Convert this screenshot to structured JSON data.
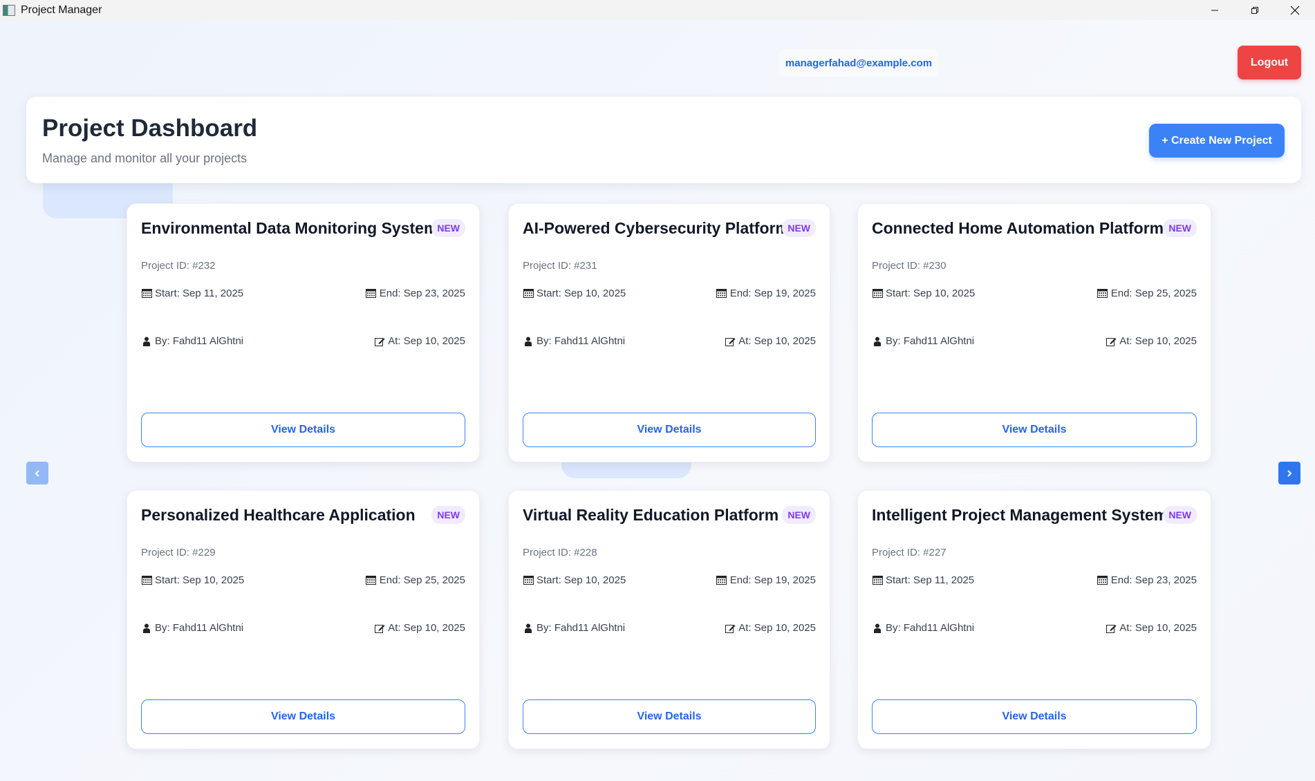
{
  "window": {
    "title": "Project Manager"
  },
  "header": {
    "user_email": "managerfahad@example.com",
    "logout_label": "Logout"
  },
  "dashboard": {
    "title": "Project Dashboard",
    "subtitle": "Manage and monitor all your projects",
    "create_label": "+ Create New Project"
  },
  "carousel": {
    "prev_label": "<",
    "next_label": ">"
  },
  "projects": [
    {
      "title": "Environmental Data Monitoring System",
      "badge": "NEW",
      "id_text": "Project ID: #232",
      "start": "Start: Sep 11, 2025",
      "end": "End: Sep 23, 2025",
      "by": "By: Fahd11 AlGhtni",
      "at": "At: Sep 10, 2025",
      "view_label": "View Details"
    },
    {
      "title": "AI-Powered Cybersecurity Platform",
      "badge": "NEW",
      "id_text": "Project ID: #231",
      "start": "Start: Sep 10, 2025",
      "end": "End: Sep 19, 2025",
      "by": "By: Fahd11 AlGhtni",
      "at": "At: Sep 10, 2025",
      "view_label": "View Details"
    },
    {
      "title": "Connected Home Automation Platform",
      "badge": "NEW",
      "id_text": "Project ID: #230",
      "start": "Start: Sep 10, 2025",
      "end": "End: Sep 25, 2025",
      "by": "By: Fahd11 AlGhtni",
      "at": "At: Sep 10, 2025",
      "view_label": "View Details"
    },
    {
      "title": "Personalized Healthcare Application",
      "badge": "NEW",
      "id_text": "Project ID: #229",
      "start": "Start: Sep 10, 2025",
      "end": "End: Sep 25, 2025",
      "by": "By: Fahd11 AlGhtni",
      "at": "At: Sep 10, 2025",
      "view_label": "View Details"
    },
    {
      "title": "Virtual Reality Education Platform",
      "badge": "NEW",
      "id_text": "Project ID: #228",
      "start": "Start: Sep 10, 2025",
      "end": "End: Sep 19, 2025",
      "by": "By: Fahd11 AlGhtni",
      "at": "At: Sep 10, 2025",
      "view_label": "View Details"
    },
    {
      "title": "Intelligent Project Management System",
      "badge": "NEW",
      "id_text": "Project ID: #227",
      "start": "Start: Sep 11, 2025",
      "end": "End: Sep 23, 2025",
      "by": "By: Fahd11 AlGhtni",
      "at": "At: Sep 10, 2025",
      "view_label": "View Details"
    }
  ],
  "icons": {
    "app": "app-window-icon",
    "minimize": "minimize-icon",
    "restore": "restore-icon",
    "close": "close-icon",
    "calendar": "calendar-icon",
    "person": "person-icon",
    "edit": "edit-note-icon"
  },
  "colors": {
    "accent": "#3b82f6",
    "danger": "#ef4444",
    "badge_text": "#7c3aed",
    "badge_bg": "#f1ecfd"
  }
}
